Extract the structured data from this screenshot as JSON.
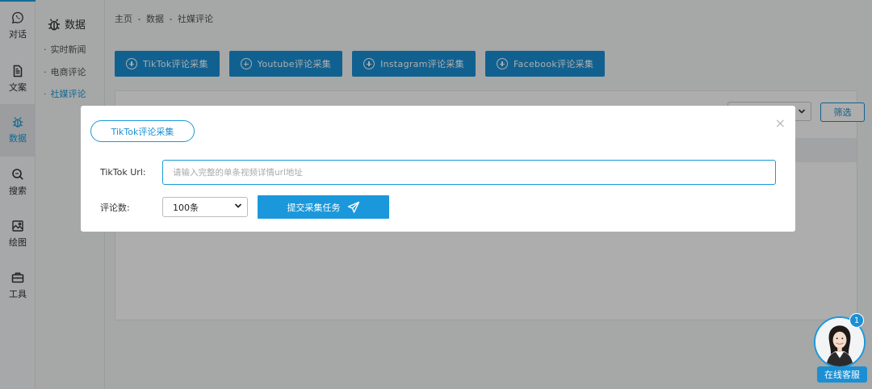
{
  "nav": {
    "items": [
      {
        "label": "对话",
        "icon": "whatsapp-icon"
      },
      {
        "label": "文案",
        "icon": "document-icon"
      },
      {
        "label": "数据",
        "icon": "bug-icon"
      },
      {
        "label": "搜索",
        "icon": "search-icon"
      },
      {
        "label": "绘图",
        "icon": "image-icon"
      },
      {
        "label": "工具",
        "icon": "toolbox-icon"
      }
    ],
    "active": "数据"
  },
  "subnav": {
    "title": "数据",
    "items": [
      {
        "label": "实时新闻"
      },
      {
        "label": "电商评论"
      },
      {
        "label": "社媒评论"
      }
    ],
    "active": "社媒评论"
  },
  "breadcrumb": {
    "items": [
      "主页",
      "数据",
      "社媒评论"
    ],
    "separator": "-"
  },
  "toolbar": {
    "buttons": [
      {
        "label": "TikTok评论采集"
      },
      {
        "label": "Youtube评论采集"
      },
      {
        "label": "Instagram评论采集"
      },
      {
        "label": "Facebook评论采集"
      }
    ]
  },
  "filter": {
    "button_label": "筛选"
  },
  "modal": {
    "title": "TikTok评论采集",
    "close_symbol": "×",
    "url_label": "TikTok Url:",
    "url_placeholder": "请输入完整的单条视频详情url地址",
    "count_label": "评论数:",
    "count_value": "100条",
    "submit_label": "提交采集任务"
  },
  "chat": {
    "badge": "1",
    "label": "在线客服"
  },
  "colors": {
    "accent": "#1a8fd4",
    "overlay": "rgba(0,0,0,0.32)"
  }
}
